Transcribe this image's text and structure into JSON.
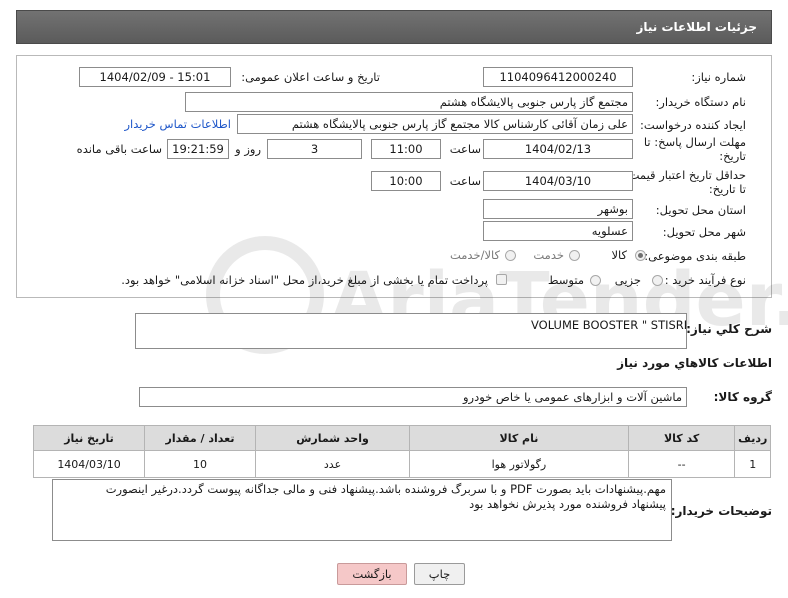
{
  "header": {
    "title": "جزئیات اطلاعات نیاز"
  },
  "form": {
    "need_number_label": "شماره نیاز:",
    "need_number": "1104096412000240",
    "announce_label": "تاریخ و ساعت اعلان عمومی:",
    "announce_value": "1404/02/09 - 15:01",
    "buyer_org_label": "نام دستگاه خریدار:",
    "buyer_org": "مجتمع گاز پارس جنوبی  پالایشگاه هشتم",
    "creator_label": "ایجاد کننده درخواست:",
    "creator": "علی زمان آقائی کارشناس کالا مجتمع گاز پارس جنوبی  پالایشگاه هشتم",
    "contact_link": "اطلاعات تماس خریدار",
    "reply_deadline_label": "مهلت ارسال پاسخ: تا تاریخ:",
    "reply_date": "1404/02/13",
    "time_label": "ساعت",
    "reply_time": "11:00",
    "days_value": "3",
    "days_label": "روز و",
    "remaining_time": "19:21:59",
    "remaining_label": "ساعت باقی مانده",
    "price_validity_label": "حداقل تاریخ اعتبار قیمت: تا تاریخ:",
    "price_date": "1404/03/10",
    "price_time": "10:00",
    "province_label": "استان محل تحویل:",
    "province": "بوشهر",
    "city_label": "شهر محل تحویل:",
    "city": "عسلویه",
    "category_label": "طبقه بندی موضوعی:",
    "category_options": [
      "کالا",
      "خدمت",
      "کالا/خدمت"
    ],
    "process_label": "نوع فرآیند خرید :",
    "process_options": [
      "جزیی",
      "متوسط"
    ],
    "payment_note": "پرداخت تمام یا بخشی از مبلغ خرید،از محل \"اسناد خزانه اسلامی\" خواهد بود."
  },
  "summary": {
    "label": "شرح کلي نياز:",
    "value": "VOLUME BOOSTER \" STISRL"
  },
  "items_section": {
    "title": "اطلاعات کالاهاي مورد نياز",
    "group_label": "گروه کالا:",
    "group_value": "ماشین آلات و ابزارهای عمومی یا خاص خودرو"
  },
  "table": {
    "headers": [
      "رديف",
      "کد کالا",
      "نام کالا",
      "واحد شمارش",
      "تعداد / مقدار",
      "تاريخ نياز"
    ],
    "rows": [
      [
        "1",
        "--",
        "رگولاتور هوا",
        "عدد",
        "10",
        "1404/03/10"
      ]
    ]
  },
  "buyer_notes": {
    "label": "توضیحات خریدار:",
    "line1": "مهم.پیشنهادات باید بصورت PDF و با سربرگ فروشنده باشد.پیشنهاد فنی و مالی جداگانه پیوست گردد.درغیر اینصورت",
    "line2": "پیشنهاد فروشنده مورد پذیرش نخواهد بود"
  },
  "buttons": {
    "print": "چاپ",
    "back": "بازگشت"
  },
  "colors": {
    "header_bg": "#656565",
    "link": "#1f57c9",
    "back_button": "#f5c8c8"
  },
  "watermark_text": "AriaTender.neT"
}
